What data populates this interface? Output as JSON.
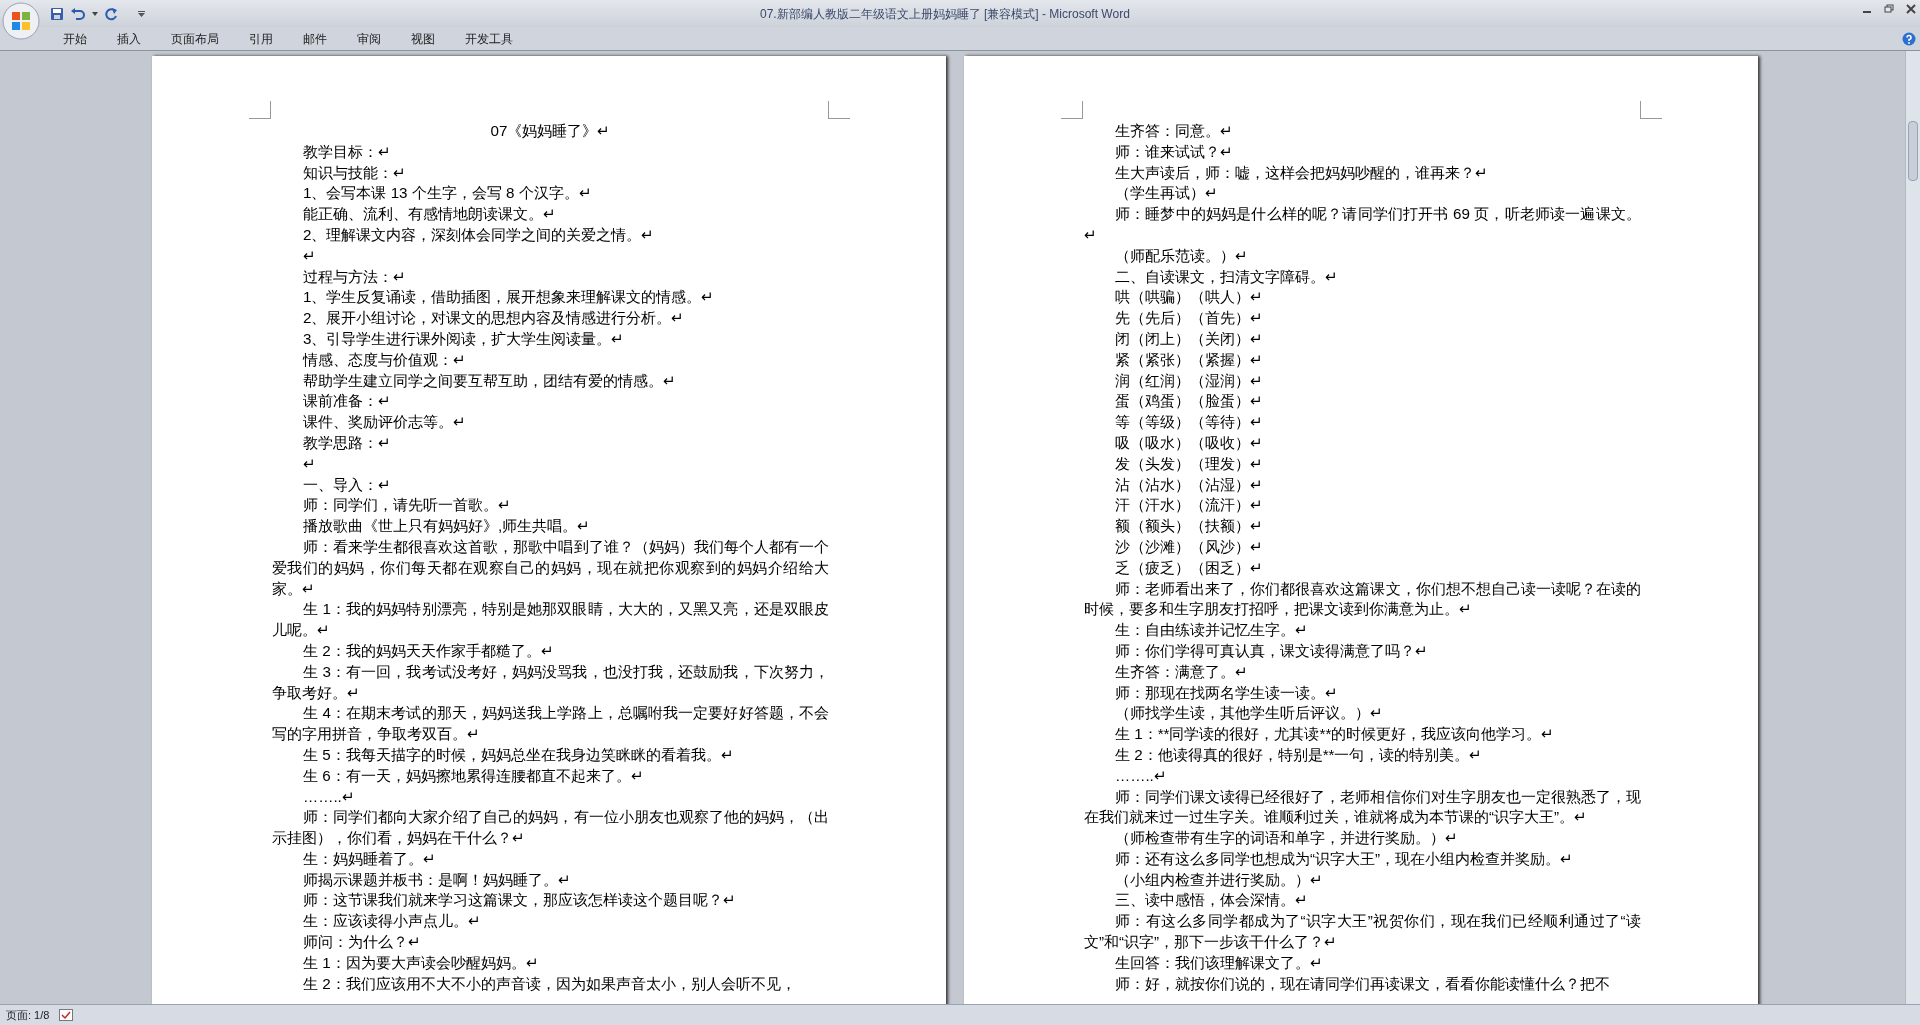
{
  "window": {
    "title": "07.新部编人教版二年级语文上册妈妈睡了 [兼容模式] - Microsoft Word"
  },
  "ribbon": {
    "tabs": [
      "开始",
      "插入",
      "页面布局",
      "引用",
      "邮件",
      "审阅",
      "视图",
      "开发工具"
    ]
  },
  "pages": [
    {
      "paragraphs": [
        {
          "kind": "title",
          "text": "07《妈妈睡了》↵"
        },
        {
          "kind": "body",
          "text": "教学目标：↵"
        },
        {
          "kind": "body",
          "text": "知识与技能：↵"
        },
        {
          "kind": "body",
          "text": "1、会写本课 13 个生字，会写 8 个汉字。↵"
        },
        {
          "kind": "body",
          "text": "能正确、流利、有感情地朗读课文。↵"
        },
        {
          "kind": "body",
          "text": "2、理解课文内容，深刻体会同学之间的关爱之情。↵"
        },
        {
          "kind": "body",
          "text": "↵"
        },
        {
          "kind": "body",
          "text": "过程与方法：↵"
        },
        {
          "kind": "body",
          "text": "1、学生反复诵读，借助插图，展开想象来理解课文的情感。↵"
        },
        {
          "kind": "body",
          "text": "2、展开小组讨论，对课文的思想内容及情感进行分析。↵"
        },
        {
          "kind": "body",
          "text": "3、引导学生进行课外阅读，扩大学生阅读量。↵"
        },
        {
          "kind": "body",
          "text": "情感、态度与价值观：↵"
        },
        {
          "kind": "body",
          "text": "帮助学生建立同学之间要互帮互助，团结有爱的情感。↵"
        },
        {
          "kind": "body",
          "text": "课前准备：↵"
        },
        {
          "kind": "body",
          "text": "课件、奖励评价志等。↵"
        },
        {
          "kind": "body",
          "text": "教学思路：↵"
        },
        {
          "kind": "body",
          "text": "↵"
        },
        {
          "kind": "body",
          "text": "一、导入：↵"
        },
        {
          "kind": "body",
          "text": "师：同学们，请先听一首歌。↵"
        },
        {
          "kind": "body",
          "text": "播放歌曲《世上只有妈妈好》,师生共唱。↵"
        },
        {
          "kind": "body",
          "text": "师：看来学生都很喜欢这首歌，那歌中唱到了谁？（妈妈）我们每个人都有一个爱我们的妈妈，你们每天都在观察自己的妈妈，现在就把你观察到的妈妈介绍给大家。↵"
        },
        {
          "kind": "body",
          "text": "生 1：我的妈妈特别漂亮，特别是她那双眼睛，大大的，又黑又亮，还是双眼皮儿呢。↵"
        },
        {
          "kind": "body",
          "text": "生 2：我的妈妈天天作家手都糙了。↵"
        },
        {
          "kind": "body",
          "text": "生 3：有一回，我考试没考好，妈妈没骂我，也没打我，还鼓励我，下次努力，争取考好。↵"
        },
        {
          "kind": "body",
          "text": "生 4：在期末考试的那天，妈妈送我上学路上，总嘱咐我一定要好好答题，不会写的字用拼音，争取考双百。↵"
        },
        {
          "kind": "body",
          "text": "生 5：我每天描字的时候，妈妈总坐在我身边笑眯眯的看着我。↵"
        },
        {
          "kind": "body",
          "text": "生 6：有一天，妈妈擦地累得连腰都直不起来了。↵"
        },
        {
          "kind": "body",
          "text": "……..↵"
        },
        {
          "kind": "body",
          "text": "师：同学们都向大家介绍了自己的妈妈，有一位小朋友也观察了他的妈妈，（出示挂图），你们看，妈妈在干什么？↵"
        },
        {
          "kind": "body",
          "text": "生：妈妈睡着了。↵"
        },
        {
          "kind": "body",
          "text": "师揭示课题并板书：是啊！妈妈睡了。↵"
        },
        {
          "kind": "body",
          "text": "师：这节课我们就来学习这篇课文，那应该怎样读这个题目呢？↵"
        },
        {
          "kind": "body",
          "text": "生：应该读得小声点儿。↵"
        },
        {
          "kind": "body",
          "text": "师问：为什么？↵"
        },
        {
          "kind": "body",
          "text": "生 1：因为要大声读会吵醒妈妈。↵"
        },
        {
          "kind": "body",
          "text": "生 2：我们应该用不大不小的声音读，因为如果声音太小，别人会听不见，"
        }
      ]
    },
    {
      "paragraphs": [
        {
          "kind": "body",
          "text": "生齐答：同意。↵"
        },
        {
          "kind": "body",
          "text": "师：谁来试试？↵"
        },
        {
          "kind": "body",
          "text": "生大声读后，师：嘘，这样会把妈妈吵醒的，谁再来？↵"
        },
        {
          "kind": "body",
          "text": "（学生再试）↵"
        },
        {
          "kind": "body",
          "text": "师：睡梦中的妈妈是什么样的呢？请同学们打开书 69 页，听老师读一遍课文。↵"
        },
        {
          "kind": "body",
          "text": "（师配乐范读。）↵"
        },
        {
          "kind": "body",
          "text": "二、自读课文，扫清文字障碍。↵"
        },
        {
          "kind": "body",
          "text": "哄（哄骗）（哄人）↵"
        },
        {
          "kind": "body",
          "text": "先（先后）（首先）↵"
        },
        {
          "kind": "body",
          "text": "闭（闭上）（关闭）↵"
        },
        {
          "kind": "body",
          "text": "紧（紧张）（紧握）↵"
        },
        {
          "kind": "body",
          "text": "润（红润）（湿润）↵"
        },
        {
          "kind": "body",
          "text": "蛋（鸡蛋）（脸蛋）↵"
        },
        {
          "kind": "body",
          "text": "等（等级）（等待）↵"
        },
        {
          "kind": "body",
          "text": "吸（吸水）（吸收）↵"
        },
        {
          "kind": "body",
          "text": "发（头发）（理发）↵"
        },
        {
          "kind": "body",
          "text": "沾（沾水）（沾湿）↵"
        },
        {
          "kind": "body",
          "text": "汗（汗水）（流汗）↵"
        },
        {
          "kind": "body",
          "text": "额（额头）（扶额）↵"
        },
        {
          "kind": "body",
          "text": "沙（沙滩）（风沙）↵"
        },
        {
          "kind": "body",
          "text": "乏（疲乏）（困乏）↵"
        },
        {
          "kind": "body",
          "text": "师：老师看出来了，你们都很喜欢这篇课文，你们想不想自己读一读呢？在读的时候，要多和生字朋友打招呼，把课文读到你满意为止。↵"
        },
        {
          "kind": "body",
          "text": "生：自由练读并记忆生字。↵"
        },
        {
          "kind": "body",
          "text": "师：你们学得可真认真，课文读得满意了吗？↵"
        },
        {
          "kind": "body",
          "text": "生齐答：满意了。↵"
        },
        {
          "kind": "body",
          "text": "师：那现在找两名学生读一读。↵"
        },
        {
          "kind": "body",
          "text": "（师找学生读，其他学生听后评议。）↵"
        },
        {
          "kind": "body",
          "text": "生 1：**同学读的很好，尤其读**的时候更好，我应该向他学习。↵"
        },
        {
          "kind": "body",
          "text": "生 2：他读得真的很好，特别是**一句，读的特别美。↵"
        },
        {
          "kind": "body",
          "text": "……..↵"
        },
        {
          "kind": "body",
          "text": "师：同学们课文读得已经很好了，老师相信你们对生字朋友也一定很熟悉了，现在我们就来过一过生字关。谁顺利过关，谁就将成为本节课的“识字大王”。↵"
        },
        {
          "kind": "body",
          "text": "（师检查带有生字的词语和单字，并进行奖励。）↵"
        },
        {
          "kind": "body",
          "text": "师：还有这么多同学也想成为“识字大王”，现在小组内检查并奖励。↵"
        },
        {
          "kind": "body",
          "text": "（小组内检查并进行奖励。）↵"
        },
        {
          "kind": "body",
          "text": "三、读中感悟，体会深情。↵"
        },
        {
          "kind": "body",
          "text": "师：有这么多同学都成为了“识字大王”祝贺你们，现在我们已经顺利通过了“读文”和“识字”，那下一步该干什么了？↵"
        },
        {
          "kind": "body",
          "text": "生回答：我们该理解课文了。↵"
        },
        {
          "kind": "body",
          "text": "师：好，就按你们说的，现在请同学们再读课文，看看你能读懂什么？把不"
        }
      ]
    }
  ],
  "status_bar": {
    "page": "页面: 1/8"
  }
}
